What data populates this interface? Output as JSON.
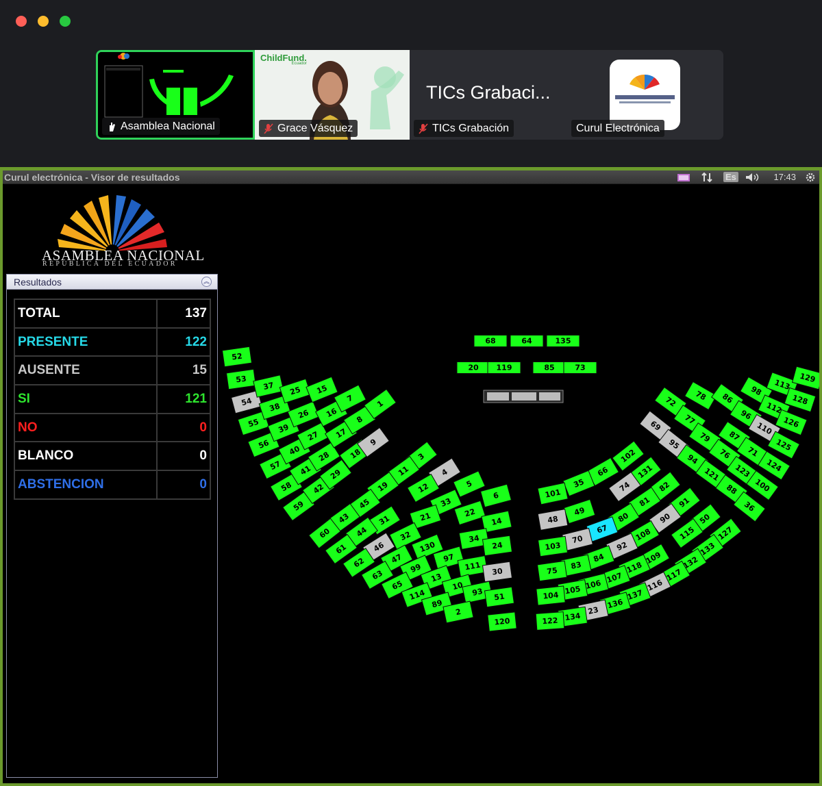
{
  "window": {
    "traffic_lights": [
      "close",
      "minimize",
      "zoom"
    ]
  },
  "participants": [
    {
      "name": "Asamblea Nacional",
      "mic": "raised-hand-icon",
      "active": true
    },
    {
      "name": "Grace Vásquez",
      "mic": "mic-muted-icon",
      "active": false,
      "logo_text": "ChildFund.",
      "logo_sub": "Ecuador"
    },
    {
      "name": "TICs Grabación",
      "mic": "mic-muted-icon",
      "active": false,
      "title": "TICs Grabaci..."
    },
    {
      "name": "Curul Electrónica",
      "mic": "",
      "active": false
    }
  ],
  "screen": {
    "title": "Curul electrónica - Visor de resultados",
    "lang": "Es",
    "clock": "17:43",
    "brand_name": "ASAMBLEA NACIONAL",
    "brand_sub": "REPÚBLICA DEL ECUADOR",
    "panel_title": "Resultados",
    "results": [
      {
        "label": "TOTAL",
        "value": "137",
        "color": "#ffffff"
      },
      {
        "label": "PRESENTE",
        "value": "122",
        "color": "#26d9e8"
      },
      {
        "label": "AUSENTE",
        "value": "15",
        "color": "#c8c8c8"
      },
      {
        "label": "SI",
        "value": "121",
        "color": "#2ee52e"
      },
      {
        "label": "NO",
        "value": "0",
        "color": "#ff1f1f"
      },
      {
        "label": "BLANCO",
        "value": "0",
        "color": "#ffffff"
      },
      {
        "label": "ABSTENCION",
        "value": "0",
        "color": "#2f6fe8"
      }
    ],
    "seat_colors": {
      "si": "#19ff19",
      "ausente": "#c4c4c4",
      "selected": "#19e6ff"
    },
    "seats": [
      {
        "n": "68",
        "s": "si"
      },
      {
        "n": "64",
        "s": "si"
      },
      {
        "n": "135",
        "s": "si"
      },
      {
        "n": "20",
        "s": "si"
      },
      {
        "n": "119",
        "s": "si"
      },
      {
        "n": "85",
        "s": "si"
      },
      {
        "n": "73",
        "s": "si"
      },
      {
        "n": "52",
        "s": "si"
      },
      {
        "n": "53",
        "s": "si"
      },
      {
        "n": "54",
        "s": "ausente"
      },
      {
        "n": "55",
        "s": "si"
      },
      {
        "n": "56",
        "s": "si"
      },
      {
        "n": "57",
        "s": "si"
      },
      {
        "n": "58",
        "s": "si"
      },
      {
        "n": "59",
        "s": "si"
      },
      {
        "n": "37",
        "s": "si"
      },
      {
        "n": "38",
        "s": "si"
      },
      {
        "n": "39",
        "s": "si"
      },
      {
        "n": "40",
        "s": "si"
      },
      {
        "n": "41",
        "s": "si"
      },
      {
        "n": "42",
        "s": "si"
      },
      {
        "n": "25",
        "s": "si"
      },
      {
        "n": "26",
        "s": "si"
      },
      {
        "n": "27",
        "s": "si"
      },
      {
        "n": "28",
        "s": "si"
      },
      {
        "n": "29",
        "s": "si"
      },
      {
        "n": "15",
        "s": "si"
      },
      {
        "n": "16",
        "s": "si"
      },
      {
        "n": "17",
        "s": "si"
      },
      {
        "n": "18",
        "s": "si"
      },
      {
        "n": "7",
        "s": "si"
      },
      {
        "n": "8",
        "s": "si"
      },
      {
        "n": "9",
        "s": "ausente"
      },
      {
        "n": "1",
        "s": "si"
      },
      {
        "n": "3",
        "s": "si"
      },
      {
        "n": "4",
        "s": "ausente"
      },
      {
        "n": "5",
        "s": "si"
      },
      {
        "n": "6",
        "s": "si"
      },
      {
        "n": "11",
        "s": "si"
      },
      {
        "n": "12",
        "s": "si"
      },
      {
        "n": "33",
        "s": "si"
      },
      {
        "n": "22",
        "s": "si"
      },
      {
        "n": "14",
        "s": "si"
      },
      {
        "n": "19",
        "s": "si"
      },
      {
        "n": "45",
        "s": "si"
      },
      {
        "n": "31",
        "s": "si"
      },
      {
        "n": "21",
        "s": "si"
      },
      {
        "n": "32",
        "s": "si"
      },
      {
        "n": "130",
        "s": "si"
      },
      {
        "n": "97",
        "s": "si"
      },
      {
        "n": "111",
        "s": "si"
      },
      {
        "n": "30",
        "s": "ausente"
      },
      {
        "n": "34",
        "s": "si"
      },
      {
        "n": "24",
        "s": "si"
      },
      {
        "n": "43",
        "s": "si"
      },
      {
        "n": "44",
        "s": "si"
      },
      {
        "n": "46",
        "s": "ausente"
      },
      {
        "n": "47",
        "s": "si"
      },
      {
        "n": "99",
        "s": "si"
      },
      {
        "n": "13",
        "s": "si"
      },
      {
        "n": "10",
        "s": "si"
      },
      {
        "n": "93",
        "s": "si"
      },
      {
        "n": "51",
        "s": "si"
      },
      {
        "n": "60",
        "s": "si"
      },
      {
        "n": "61",
        "s": "si"
      },
      {
        "n": "62",
        "s": "si"
      },
      {
        "n": "63",
        "s": "si"
      },
      {
        "n": "65",
        "s": "si"
      },
      {
        "n": "114",
        "s": "si"
      },
      {
        "n": "89",
        "s": "si"
      },
      {
        "n": "2",
        "s": "si"
      },
      {
        "n": "120",
        "s": "si"
      },
      {
        "n": "72",
        "s": "si"
      },
      {
        "n": "78",
        "s": "si"
      },
      {
        "n": "86",
        "s": "si"
      },
      {
        "n": "98",
        "s": "si"
      },
      {
        "n": "113",
        "s": "si"
      },
      {
        "n": "129",
        "s": "si"
      },
      {
        "n": "69",
        "s": "ausente"
      },
      {
        "n": "77",
        "s": "si"
      },
      {
        "n": "96",
        "s": "si"
      },
      {
        "n": "112",
        "s": "si"
      },
      {
        "n": "128",
        "s": "si"
      },
      {
        "n": "95",
        "s": "ausente"
      },
      {
        "n": "79",
        "s": "si"
      },
      {
        "n": "87",
        "s": "si"
      },
      {
        "n": "110",
        "s": "ausente"
      },
      {
        "n": "126",
        "s": "si"
      },
      {
        "n": "94",
        "s": "si"
      },
      {
        "n": "76",
        "s": "si"
      },
      {
        "n": "71",
        "s": "si"
      },
      {
        "n": "125",
        "s": "si"
      },
      {
        "n": "121",
        "s": "si"
      },
      {
        "n": "123",
        "s": "si"
      },
      {
        "n": "124",
        "s": "si"
      },
      {
        "n": "88",
        "s": "si"
      },
      {
        "n": "100",
        "s": "si"
      },
      {
        "n": "36",
        "s": "si"
      },
      {
        "n": "102",
        "s": "si"
      },
      {
        "n": "66",
        "s": "si"
      },
      {
        "n": "35",
        "s": "si"
      },
      {
        "n": "101",
        "s": "si"
      },
      {
        "n": "131",
        "s": "si"
      },
      {
        "n": "74",
        "s": "ausente"
      },
      {
        "n": "49",
        "s": "si"
      },
      {
        "n": "48",
        "s": "ausente"
      },
      {
        "n": "82",
        "s": "si"
      },
      {
        "n": "81",
        "s": "si"
      },
      {
        "n": "80",
        "s": "si"
      },
      {
        "n": "67",
        "s": "selected"
      },
      {
        "n": "70",
        "s": "ausente"
      },
      {
        "n": "103",
        "s": "si"
      },
      {
        "n": "91",
        "s": "si"
      },
      {
        "n": "90",
        "s": "ausente"
      },
      {
        "n": "108",
        "s": "si"
      },
      {
        "n": "92",
        "s": "ausente"
      },
      {
        "n": "84",
        "s": "si"
      },
      {
        "n": "83",
        "s": "si"
      },
      {
        "n": "75",
        "s": "si"
      },
      {
        "n": "50",
        "s": "si"
      },
      {
        "n": "115",
        "s": "si"
      },
      {
        "n": "109",
        "s": "si"
      },
      {
        "n": "118",
        "s": "si"
      },
      {
        "n": "107",
        "s": "si"
      },
      {
        "n": "106",
        "s": "si"
      },
      {
        "n": "105",
        "s": "si"
      },
      {
        "n": "104",
        "s": "si"
      },
      {
        "n": "127",
        "s": "si"
      },
      {
        "n": "133",
        "s": "si"
      },
      {
        "n": "132",
        "s": "si"
      },
      {
        "n": "117",
        "s": "si"
      },
      {
        "n": "116",
        "s": "ausente"
      },
      {
        "n": "137",
        "s": "si"
      },
      {
        "n": "136",
        "s": "si"
      },
      {
        "n": "23",
        "s": "ausente"
      },
      {
        "n": "134",
        "s": "si"
      },
      {
        "n": "122",
        "s": "si"
      }
    ]
  }
}
